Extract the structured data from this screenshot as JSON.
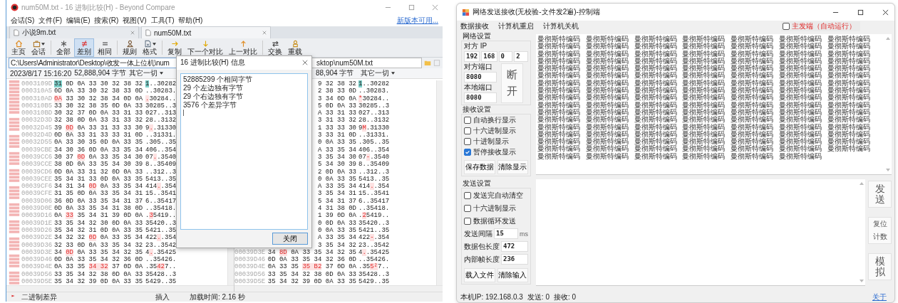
{
  "left_window": {
    "title": "num50M.txt - 16 进制比较(H) - Beyond Compare",
    "menu": [
      "会话(S)",
      "文件(F)",
      "编辑(E)",
      "搜索(R)",
      "视图(V)",
      "工具(T)",
      "帮助(H)"
    ],
    "update_link": "新版本可用...",
    "tabs": [
      {
        "label": "小说9m.txt",
        "selected": false
      },
      {
        "label": "num50M.txt",
        "selected": true
      }
    ],
    "toolbar": [
      {
        "label": "主页",
        "selected": false,
        "dropdown": false
      },
      {
        "label": "会话",
        "selected": false,
        "dropdown": true
      },
      {
        "label": "全部",
        "selected": false,
        "dropdown": false
      },
      {
        "label": "差别",
        "selected": true,
        "dropdown": false
      },
      {
        "label": "相同",
        "selected": false,
        "dropdown": false
      },
      {
        "label": "规则",
        "selected": false,
        "dropdown": false
      },
      {
        "label": "格式",
        "selected": false,
        "dropdown": true
      },
      {
        "label": "复制",
        "selected": false,
        "dropdown": false
      },
      {
        "label": "下一个对比",
        "selected": false,
        "dropdown": false
      },
      {
        "label": "上一对比",
        "selected": false,
        "dropdown": false
      },
      {
        "label": "交换",
        "selected": false,
        "dropdown": false
      },
      {
        "label": "重载",
        "selected": false,
        "dropdown": false
      }
    ],
    "left_pane": {
      "path": "C:\\Users\\Administrator\\Desktop\\收发一体上位机\\num",
      "date": "2023/8/17 15:16:20",
      "size": "52,888,904 字节",
      "filter": "其它一切"
    },
    "right_pane": {
      "path": "sktop\\num50M.txt",
      "size": "88,904 字节",
      "filter": "其它一切"
    },
    "left_rows": [
      {
        "address": "0003109D",
        "hex": [
          {
            "text": "31",
            "kind": "cursor"
          },
          {
            "text": " 0D 0A 33 30 32 38 32",
            "kind": "plain"
          }
        ],
        "ascii": [
          {
            "text": "1",
            "kind": "cursor"
          },
          {
            "text": "..30282",
            "kind": "plain"
          }
        ]
      },
      {
        "address": "000310A5",
        "hex": [
          {
            "text": "0D 0A 33 30 32 38 33 0D",
            "kind": "plain"
          }
        ],
        "ascii": [
          {
            "text": "..30283.",
            "kind": "plain"
          }
        ]
      },
      {
        "address": "000310AD",
        "hex": [
          {
            "text": "0A",
            "kind": "diff"
          },
          {
            "text": " 33 30 32 38 34 0D 0A",
            "kind": "plain"
          }
        ],
        "ascii": [
          {
            "text": ".",
            "kind": "diff"
          },
          {
            "text": "30284..",
            "kind": "plain"
          }
        ]
      },
      {
        "address": "000310B5",
        "hex": [
          {
            "text": "33 30 32 38 35 0D 0A 33",
            "kind": "plain"
          }
        ],
        "ascii": [
          {
            "text": "30285..3",
            "kind": "plain"
          }
        ]
      },
      {
        "address": "000310BD",
        "hex": [
          {
            "text": "30 32 37 0D 0A 33 31 33",
            "kind": "plain"
          }
        ],
        "ascii": [
          {
            "text": "027..313",
            "kind": "plain"
          }
        ]
      },
      {
        "address": "00032D3D",
        "hex": [
          {
            "text": "32 38 0D 0A 33 31 33 32",
            "kind": "plain"
          }
        ],
        "ascii": [
          {
            "text": "28..3132",
            "kind": "plain"
          }
        ]
      },
      {
        "address": "00032D45",
        "hex": [
          {
            "text": "39 ",
            "kind": "plain"
          },
          {
            "text": "0D",
            "kind": "diff"
          },
          {
            "text": " 0A 33 31 33 33 30",
            "kind": "plain"
          }
        ],
        "ascii": [
          {
            "text": "9",
            "kind": "plain"
          },
          {
            "text": ".",
            "kind": "diff"
          },
          {
            "text": ".31330",
            "kind": "plain"
          }
        ]
      },
      {
        "address": "00032D4D",
        "hex": [
          {
            "text": "0D 0A 33 31 33 33 31 0D",
            "kind": "plain"
          }
        ],
        "ascii": [
          {
            "text": "..31331.",
            "kind": "plain"
          }
        ]
      },
      {
        "address": "00032D55",
        "hex": [
          {
            "text": "0A 33 30 35 0D 0A 33 35",
            "kind": "plain"
          }
        ],
        "ascii": [
          {
            "text": ".305..35",
            "kind": "plain"
          }
        ]
      },
      {
        "address": "00039CBE",
        "hex": [
          {
            "text": "34 30 36 0D 0A 33 35 34",
            "kind": "plain"
          }
        ],
        "ascii": [
          {
            "text": "406..354",
            "kind": "plain"
          }
        ]
      },
      {
        "address": "00039CC6",
        "hex": [
          {
            "text": "30 37 ",
            "kind": "plain"
          },
          {
            "text": "0D",
            "kind": "diff"
          },
          {
            "text": " 0A 33 35 34 30",
            "kind": "plain"
          }
        ],
        "ascii": [
          {
            "text": "07",
            "kind": "plain"
          },
          {
            "text": ".",
            "kind": "diff"
          },
          {
            "text": ".3540",
            "kind": "plain"
          }
        ]
      },
      {
        "address": "00039CCE",
        "hex": [
          {
            "text": "38 0D 0A 33 35 34 30 39",
            "kind": "plain"
          }
        ],
        "ascii": [
          {
            "text": "8..35409",
            "kind": "plain"
          }
        ]
      },
      {
        "address": "00039CD6",
        "hex": [
          {
            "text": "0D 0A 33 31 32 0D 0A 33",
            "kind": "plain"
          }
        ],
        "ascii": [
          {
            "text": "..312..3",
            "kind": "plain"
          }
        ]
      },
      {
        "address": "00039CEE",
        "hex": [
          {
            "text": "35 34 31 33 0D 0A 33 35",
            "kind": "plain"
          }
        ],
        "ascii": [
          {
            "text": "5413..35",
            "kind": "plain"
          }
        ]
      },
      {
        "address": "00039CF6",
        "hex": [
          {
            "text": "34 31 34 ",
            "kind": "plain"
          },
          {
            "text": "0D",
            "kind": "diff"
          },
          {
            "text": " 0A 33 35 34",
            "kind": "plain"
          }
        ],
        "ascii": [
          {
            "text": "414",
            "kind": "plain"
          },
          {
            "text": ".",
            "kind": "diff"
          },
          {
            "text": ".354",
            "kind": "plain"
          }
        ]
      },
      {
        "address": "00039CFE",
        "hex": [
          {
            "text": "31 35 0D 0A 33 35 34 31",
            "kind": "plain"
          }
        ],
        "ascii": [
          {
            "text": "15..3541",
            "kind": "plain"
          }
        ]
      },
      {
        "address": "00039D06",
        "hex": [
          {
            "text": "36 0D 0A 33 35 34 31 37",
            "kind": "plain"
          }
        ],
        "ascii": [
          {
            "text": "6..35417",
            "kind": "plain"
          }
        ]
      },
      {
        "address": "00039D0E",
        "hex": [
          {
            "text": "0D 0A 33 35 34 31 38 0D",
            "kind": "plain"
          }
        ],
        "ascii": [
          {
            "text": "..35418.",
            "kind": "plain"
          }
        ]
      },
      {
        "address": "00039D16",
        "hex": [
          {
            "text": "0A ",
            "kind": "plain"
          },
          {
            "text": "33",
            "kind": "diff"
          },
          {
            "text": " 35 34 31 39 0D 0A",
            "kind": "plain"
          }
        ],
        "ascii": [
          {
            "text": ".",
            "kind": "plain"
          },
          {
            "text": "3",
            "kind": "diff"
          },
          {
            "text": "5419..",
            "kind": "plain"
          }
        ]
      },
      {
        "address": "00039D1E",
        "hex": [
          {
            "text": "33 35 34 32 30 0D 0A 33",
            "kind": "plain"
          }
        ],
        "ascii": [
          {
            "text": "35420..3",
            "kind": "plain"
          }
        ]
      },
      {
        "address": "00039D26",
        "hex": [
          {
            "text": "35 34 32 31 0D 0A 33 35",
            "kind": "plain"
          }
        ],
        "ascii": [
          {
            "text": "5421..35",
            "kind": "plain"
          }
        ]
      },
      {
        "address": "00039D2E",
        "hex": [
          {
            "text": "34 32 32 ",
            "kind": "plain"
          },
          {
            "text": "0D",
            "kind": "diff"
          },
          {
            "text": " 0A 33 35 34",
            "kind": "plain"
          }
        ],
        "ascii": [
          {
            "text": "422",
            "kind": "plain"
          },
          {
            "text": ".",
            "kind": "diff"
          },
          {
            "text": ".354",
            "kind": "plain"
          }
        ]
      },
      {
        "address": "00039D36",
        "hex": [
          {
            "text": "32 33 0D 0A 33 35 34 32",
            "kind": "plain"
          }
        ],
        "ascii": [
          {
            "text": "23..3542",
            "kind": "plain"
          }
        ]
      },
      {
        "address": "00039D3E",
        "hex": [
          {
            "text": "34 ",
            "kind": "plain"
          },
          {
            "text": "0D",
            "kind": "diff"
          },
          {
            "text": " 0A 33 35 34 32 35",
            "kind": "plain"
          }
        ],
        "ascii": [
          {
            "text": "4",
            "kind": "plain"
          },
          {
            "text": ".",
            "kind": "diff"
          },
          {
            "text": ".35425",
            "kind": "plain"
          }
        ]
      },
      {
        "address": "00039D46",
        "hex": [
          {
            "text": "0D 0A 33 35 34 32 36 0D",
            "kind": "plain"
          }
        ],
        "ascii": [
          {
            "text": "..35426.",
            "kind": "plain"
          }
        ]
      },
      {
        "address": "00039D4E",
        "hex": [
          {
            "text": "0A 33 35 ",
            "kind": "plain"
          },
          {
            "text": "34 32",
            "kind": "diff"
          },
          {
            "text": " 37 0D 0A",
            "kind": "plain"
          }
        ],
        "ascii": [
          {
            "text": ".35",
            "kind": "plain"
          },
          {
            "text": "42",
            "kind": "diff"
          },
          {
            "text": "7..",
            "kind": "plain"
          }
        ]
      },
      {
        "address": "00039D56",
        "hex": [
          {
            "text": "33 35 34 32 38 0D 0A 33",
            "kind": "plain"
          }
        ],
        "ascii": [
          {
            "text": "35428..3",
            "kind": "plain"
          }
        ]
      },
      {
        "address": "00039D5E",
        "hex": [
          {
            "text": "35 34 32 39 0D 0A 33 35",
            "kind": "plain"
          }
        ],
        "ascii": [
          {
            "text": "5429..35",
            "kind": "plain"
          }
        ]
      }
    ],
    "right_rows": [
      {
        "hex": [
          {
            "text": "9 32 38 32",
            "kind": "plain"
          }
        ],
        "ascii": [
          {
            "text": "1",
            "kind": "cursor"
          },
          {
            "text": "..30282",
            "kind": "plain"
          }
        ]
      },
      {
        "hex": [
          {
            "text": "2 38 33 0D",
            "kind": "plain"
          }
        ],
        "ascii": [
          {
            "text": "..30283.",
            "kind": "plain"
          }
        ]
      },
      {
        "hex": [
          {
            "text": "3 34 0D 0A",
            "kind": "plain"
          }
        ],
        "ascii": [
          {
            "text": "*",
            "kind": "diff"
          },
          {
            "text": "30284..",
            "kind": "plain"
          }
        ]
      },
      {
        "hex": [
          {
            "text": "5 0D 0A 33",
            "kind": "plain"
          }
        ],
        "ascii": [
          {
            "text": "30285..3",
            "kind": "plain"
          }
        ]
      },
      {
        "hex": [
          {
            "text": "A 33 31 33",
            "kind": "plain"
          }
        ],
        "ascii": [
          {
            "text": "027..313",
            "kind": "plain"
          }
        ]
      },
      {
        "hex": [
          {
            "text": "3 31 33 32",
            "kind": "plain"
          }
        ],
        "ascii": [
          {
            "text": "28..3132",
            "kind": "plain"
          }
        ]
      },
      {
        "hex": [
          {
            "text": "1 33 33 30",
            "kind": "plain"
          }
        ],
        "ascii": [
          {
            "text": "9",
            "kind": "plain"
          },
          {
            "text": "M",
            "kind": "diff"
          },
          {
            "text": ".31330",
            "kind": "plain"
          }
        ]
      },
      {
        "hex": [
          {
            "text": "3 33 31 0D",
            "kind": "plain"
          }
        ],
        "ascii": [
          {
            "text": "..31331.",
            "kind": "plain"
          }
        ]
      },
      {
        "hex": [
          {
            "text": "0 0A 33 35",
            "kind": "plain"
          }
        ],
        "ascii": [
          {
            "text": ".305..35",
            "kind": "plain"
          }
        ]
      },
      {
        "hex": [
          {
            "text": "A 33 35 34",
            "kind": "plain"
          }
        ],
        "ascii": [
          {
            "text": "406..354",
            "kind": "plain"
          }
        ]
      },
      {
        "hex": [
          {
            "text": "3 35 34 30",
            "kind": "plain"
          }
        ],
        "ascii": [
          {
            "text": "07",
            "kind": "plain"
          },
          {
            "text": "-",
            "kind": "diff"
          },
          {
            "text": ".3540",
            "kind": "plain"
          }
        ]
      },
      {
        "hex": [
          {
            "text": "5 34 30 39",
            "kind": "plain"
          }
        ],
        "ascii": [
          {
            "text": "8..35409",
            "kind": "plain"
          }
        ]
      },
      {
        "hex": [
          {
            "text": "2 0D 0A 33",
            "kind": "plain"
          }
        ],
        "ascii": [
          {
            "text": "..312..3",
            "kind": "plain"
          }
        ]
      },
      {
        "hex": [
          {
            "text": "0 0A 33 35",
            "kind": "plain"
          }
        ],
        "ascii": [
          {
            "text": "5413..35",
            "kind": "plain"
          }
        ]
      },
      {
        "hex": [
          {
            "text": "A 33 35 34",
            "kind": "plain"
          }
        ],
        "ascii": [
          {
            "text": "414",
            "kind": "plain"
          },
          {
            "text": ".",
            "kind": "diff"
          },
          {
            "text": ".354",
            "kind": "plain"
          }
        ]
      },
      {
        "hex": [
          {
            "text": "3 35 34 31",
            "kind": "plain"
          }
        ],
        "ascii": [
          {
            "text": "15..3541",
            "kind": "plain"
          }
        ]
      },
      {
        "hex": [
          {
            "text": "5 34 31 37",
            "kind": "plain"
          }
        ],
        "ascii": [
          {
            "text": "6..35417",
            "kind": "plain"
          }
        ]
      },
      {
        "hex": [
          {
            "text": "4 31 38 0D",
            "kind": "plain"
          }
        ],
        "ascii": [
          {
            "text": "..35418.",
            "kind": "plain"
          }
        ]
      },
      {
        "hex": [
          {
            "text": "1 39 0D 0A",
            "kind": "plain"
          }
        ],
        "ascii": [
          {
            "text": ".",
            "kind": "plain"
          },
          {
            "text": "2",
            "kind": "diff"
          },
          {
            "text": "5419..",
            "kind": "plain"
          }
        ]
      },
      {
        "hex": [
          {
            "text": "0 0D 0A 33",
            "kind": "plain"
          }
        ],
        "ascii": [
          {
            "text": "35420..3",
            "kind": "plain"
          }
        ]
      },
      {
        "hex": [
          {
            "text": "0 0A 33 35",
            "kind": "plain"
          }
        ],
        "ascii": [
          {
            "text": "5421..35",
            "kind": "plain"
          }
        ]
      },
      {
        "hex": [
          {
            "text": "A 33 35 34",
            "kind": "plain"
          }
        ],
        "ascii": [
          {
            "text": "422",
            "kind": "plain"
          },
          {
            "text": "-",
            "kind": "diff"
          },
          {
            "text": ".354",
            "kind": "plain"
          }
        ]
      },
      {
        "hex": [
          {
            "text": "3 35 34 32",
            "kind": "plain"
          }
        ],
        "ascii": [
          {
            "text": "23..3542",
            "kind": "plain"
          }
        ]
      },
      {
        "address": "00039D3E",
        "hex": [
          {
            "text": "34 ",
            "kind": "plain"
          },
          {
            "text": "8D",
            "kind": "diff"
          },
          {
            "text": " 0A 33 35 34 32 35",
            "kind": "plain"
          }
        ],
        "ascii": [
          {
            "text": "4",
            "kind": "plain"
          },
          {
            "text": ".",
            "kind": "diff"
          },
          {
            "text": ".35425",
            "kind": "plain"
          }
        ]
      },
      {
        "address": "00039D46",
        "hex": [
          {
            "text": "0D 0A 33 35 34 32 36 0D",
            "kind": "plain"
          }
        ],
        "ascii": [
          {
            "text": "..35426.",
            "kind": "plain"
          }
        ]
      },
      {
        "address": "00039D4E",
        "hex": [
          {
            "text": "0A 33 35 ",
            "kind": "plain"
          },
          {
            "text": "35 B2",
            "kind": "diff"
          },
          {
            "text": " 37 0D 0A",
            "kind": "plain"
          }
        ],
        "ascii": [
          {
            "text": ".35",
            "kind": "plain"
          },
          {
            "text": "5²",
            "kind": "diff"
          },
          {
            "text": "7..",
            "kind": "plain"
          }
        ]
      },
      {
        "address": "00039D56",
        "hex": [
          {
            "text": "33 35 34 32 38 0D 0A 33",
            "kind": "plain"
          }
        ],
        "ascii": [
          {
            "text": "35428..3",
            "kind": "plain"
          }
        ]
      },
      {
        "address": "00039D5E",
        "hex": [
          {
            "text": "35 34 32 39 0D 0A 33 35",
            "kind": "plain"
          }
        ],
        "ascii": [
          {
            "text": "5429..35",
            "kind": "plain"
          }
        ]
      }
    ],
    "dialog": {
      "title": "16 进制比较(H) 信息",
      "lines": [
        "52885299 个相同字节",
        "29 个左边独有字节",
        "29 个右边独有字节",
        "3576 个差异字节"
      ],
      "button": "关闭"
    },
    "status_bar": {
      "mode": "二进制差异",
      "insert": "插入",
      "load_time": "加载时间:  2.16 秒"
    }
  },
  "right_window": {
    "title": "网络发送接收(无校验-文件发2遍)-控制端",
    "menu": [
      "数据接收",
      "计算机重启",
      "计算机关机"
    ],
    "master_checkbox": {
      "label": "主发端（自动运行）",
      "checked": false
    },
    "network": {
      "title": "网络设置",
      "ip_label": "对方 IP",
      "ip": [
        "192",
        "168",
        "0",
        "2"
      ],
      "remote_port_label": "对方端口",
      "remote_port": "8080",
      "local_port_label": "本地端口",
      "local_port": "8080",
      "connect_button": "断开"
    },
    "receive": {
      "title": "接收设置",
      "options": [
        {
          "label": "自动换行显示",
          "checked": false
        },
        {
          "label": "十六进制显示",
          "checked": false
        },
        {
          "label": "十进制显示",
          "checked": false
        },
        {
          "label": "暂停接收显示",
          "checked": true
        }
      ],
      "buttons": [
        "保存数据",
        "清除显示"
      ]
    },
    "send": {
      "title": "发送设置",
      "options": [
        {
          "label": "发送完自动清空",
          "checked": false
        },
        {
          "label": "十六进制显示",
          "checked": false
        },
        {
          "label": "数据循环发送",
          "checked": false
        }
      ],
      "fields": [
        {
          "label": "发送间隔",
          "value": "15",
          "unit": "ms"
        },
        {
          "label": "数据包长度",
          "value": "472"
        },
        {
          "label": "内部帧长度",
          "value": "236"
        }
      ],
      "buttons": [
        "载入文件",
        "清除输入"
      ]
    },
    "receive_text": [
      "曼彻斯特编码 曼彻斯特编码 曼彻斯特编码 曼彻斯特编码 曼彻斯特编码 曼彻斯特编码 曼彻斯特编码",
      "曼彻斯特编码 曼彻斯特编码 曼彻斯特编码 曼彻斯特编码 曼彻斯特编码 曼彻斯特编码 曼彻斯特编码",
      "曼彻斯特编码 曼彻斯特编码 曼彻斯特编码 曼彻斯特编码 曼彻斯特编码 曼彻斯特编码 曼彻斯特编码",
      "曼彻斯特编码 曼彻斯特编码 曼彻斯特编码 曼彻斯特编码 曼彻斯特编码 曼彻斯特编码 曼彻斯特编码",
      "曼彻斯特编码 曼彻斯特编码 曼彻斯特编码 曼彻斯特编码 曼彻斯特编码 曼彻斯特编码 曼彻斯特编码",
      "曼彻斯特编码 曼彻斯特编码 曼彻斯特编码 曼彻斯特编码 曼彻斯特编码 曼彻斯特编码 曼彻斯特编码",
      "曼彻斯特编码 曼彻斯特编码 曼彻斯特编码 曼彻斯特编码 曼彻斯特编码 曼彻斯特编码 曼彻斯特编码",
      "曼彻斯特编码 曼彻斯特编码 曼彻斯特编码 曼彻斯特编码 曼彻斯特编码 曼彻斯特编码 曼彻斯特编码",
      "曼彻斯特编码 曼彻斯特编码 曼彻斯特编码 曼彻斯特编码 曼彻斯特编码 曼彻斯特编码 曼彻斯特编码",
      "曼彻斯特编码 曼彻斯特编码 曼彻斯特编码 曼彻斯特编码 曼彻斯特编码 曼彻斯特编码 曼彻斯特编码",
      "曼彻斯特编码 曼彻斯特编码 曼彻斯特编码 曼彻斯特编码 曼彻斯特编码 曼彻斯特编码 曼彻斯特编码",
      "曼彻斯特编码 曼彻斯特编码 曼彻斯特编码 曼彻斯特编码 曼彻斯特编码 曼彻斯特编码 曼彻斯特编码",
      "曼彻斯特编码 曼彻斯特编码 曼彻斯特编码 曼彻斯特编码 曼彻斯特编码 曼彻斯特编码 曼彻斯特编码",
      "曼彻斯特编码 曼彻斯特编码 曼彻斯特编码 曼彻斯特编码 曼彻斯特编码 曼彻斯特编码 曼彻斯特编码",
      "曼彻斯特编码 曼彻斯特编码 曼彻斯特编码 曼彻斯特编码 曼彻斯特编码 曼彻斯特编码 曼彻斯特编码",
      "曼彻斯特编码 曼彻斯特编码 曼彻斯特编码 曼彻斯特编码 曼彻斯特编码 曼彻斯特编码 曼彻斯特编码",
      "曼彻斯特编码 曼彻斯特编码 曼彻斯特编码 曼彻斯特编码 曼彻斯特编码 曼彻斯特编码"
    ],
    "side_buttons": [
      {
        "label": "发送",
        "kind": "large"
      },
      {
        "label": "复位计数",
        "kind": "small"
      },
      {
        "label": "模拟",
        "kind": "large"
      }
    ],
    "status": [
      "本机IP:  192.168.0.3",
      "发送:  0",
      "接收:  0"
    ],
    "about_link": "关于"
  }
}
